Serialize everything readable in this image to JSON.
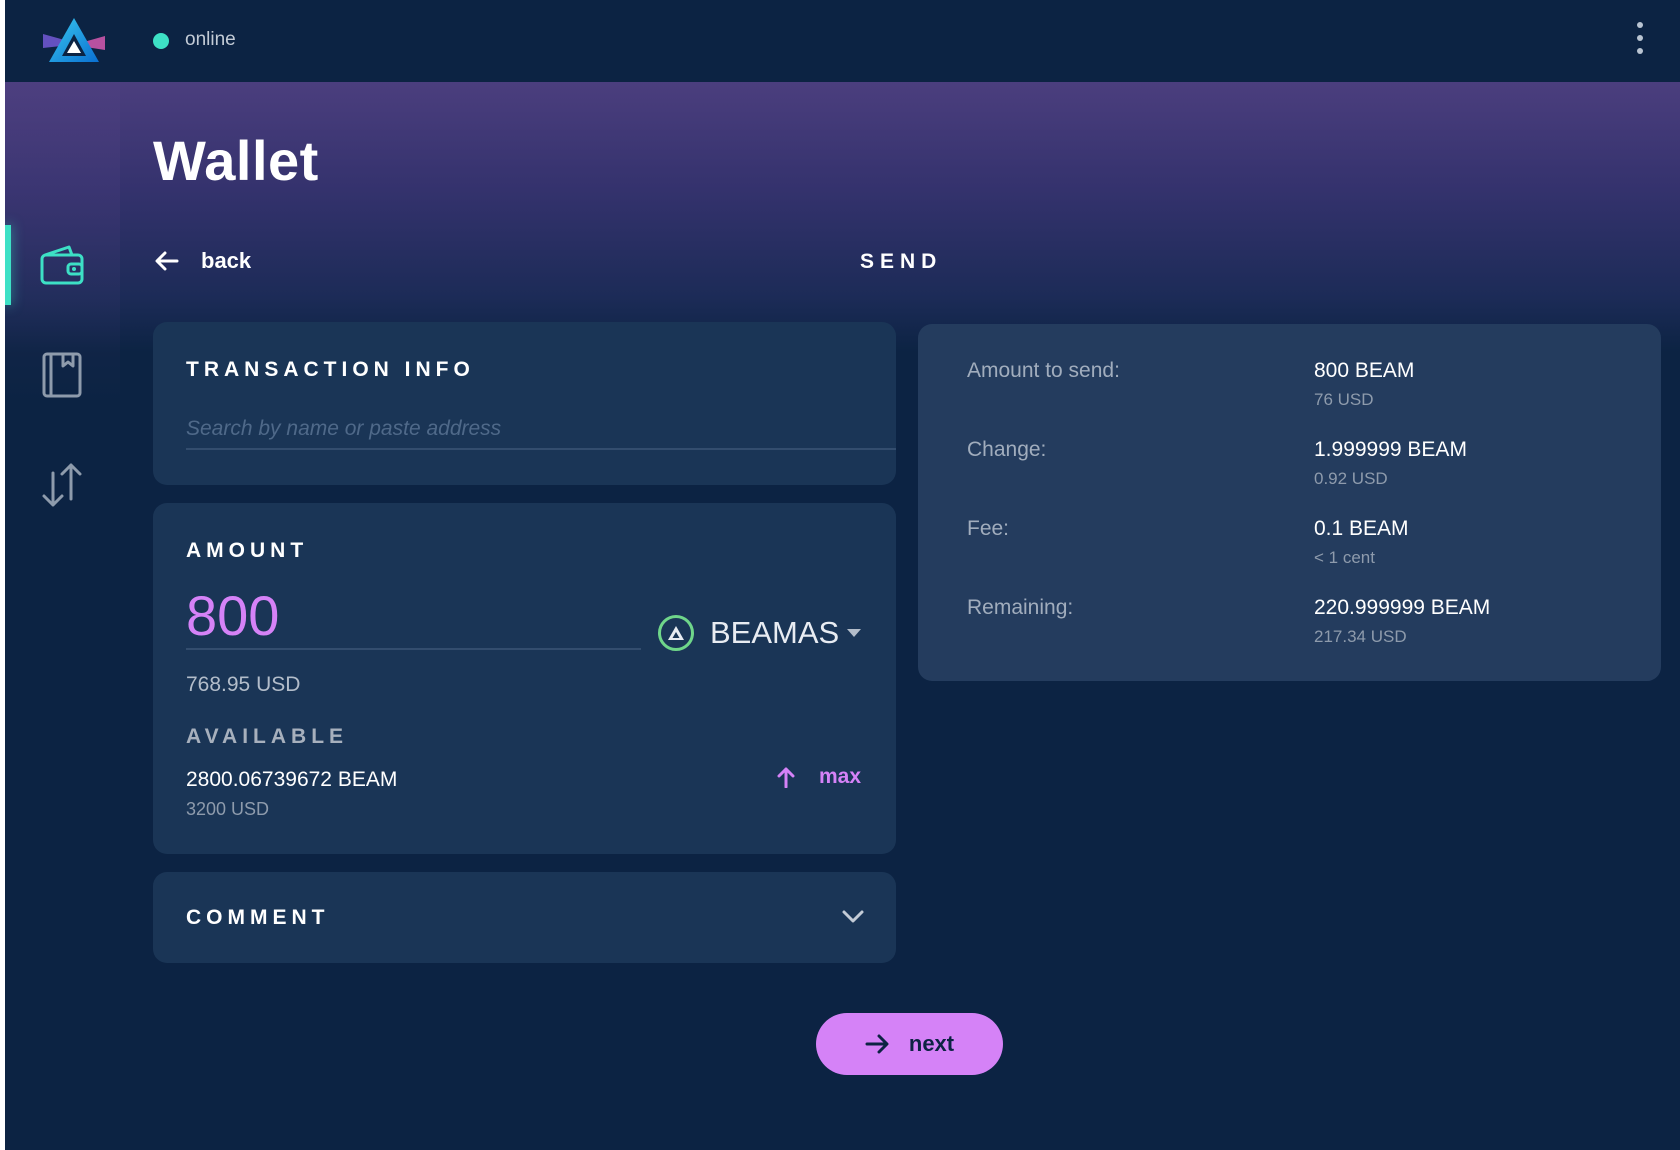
{
  "header": {
    "status": "online",
    "status_color": "#3de0c5",
    "logo_icon": "beam-logo",
    "menu_icon": "more-vertical-icon"
  },
  "sidebar": {
    "items": [
      {
        "icon": "wallet-icon",
        "active": true
      },
      {
        "icon": "address-book-icon",
        "active": false
      },
      {
        "icon": "transactions-icon",
        "active": false
      }
    ]
  },
  "page": {
    "title": "Wallet",
    "back_label": "back",
    "section_title": "SEND"
  },
  "transaction_info": {
    "label": "TRANSACTION INFO",
    "search_placeholder": "Search by name or paste address",
    "search_value": ""
  },
  "amount": {
    "label": "AMOUNT",
    "value": "800",
    "usd": "768.95 USD",
    "asset": "BEAMAS",
    "available_label": "AVAILABLE",
    "available_amount": "2800.06739672 BEAM",
    "available_usd": "3200 USD",
    "max_label": "max"
  },
  "comment": {
    "label": "COMMENT"
  },
  "summary": {
    "rows": [
      {
        "label": "Amount to send:",
        "value": "800 BEAM",
        "sub": "76 USD"
      },
      {
        "label": "Change:",
        "value": "1.999999 BEAM",
        "sub": "0.92 USD"
      },
      {
        "label": "Fee:",
        "value": "0.1 BEAM",
        "sub": "< 1 cent"
      },
      {
        "label": "Remaining:",
        "value": "220.999999 BEAM",
        "sub": "217.34 USD"
      }
    ]
  },
  "actions": {
    "next_label": "next"
  },
  "colors": {
    "background": "#0c2343",
    "card": "#1a3556",
    "accent_purple": "#d582f7",
    "accent_teal": "#3de0c5"
  }
}
